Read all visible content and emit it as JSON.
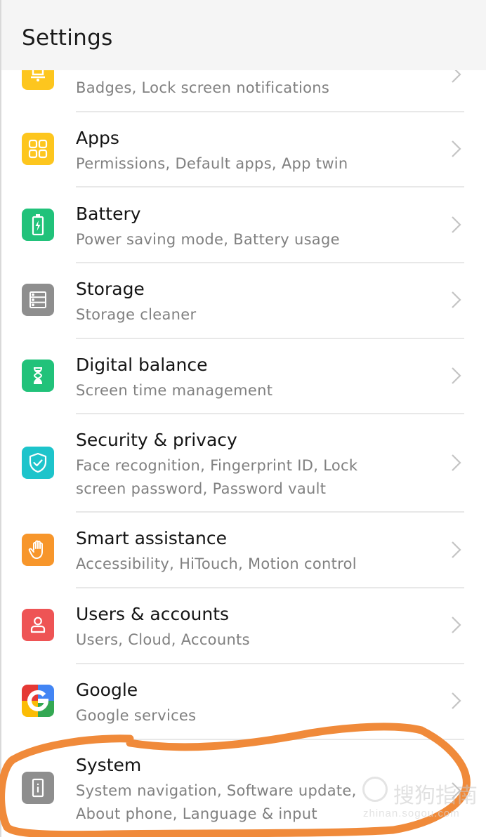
{
  "header": {
    "title": "Settings"
  },
  "items": [
    {
      "key": "notifications",
      "title": "",
      "subtitle_lines": [
        "Badges, Lock screen notifications"
      ],
      "icon": "bell-icon",
      "icon_color": "#FDC61E"
    },
    {
      "key": "apps",
      "title": "Apps",
      "subtitle_lines": [
        "Permissions, Default apps, App twin"
      ],
      "icon": "apps-grid-icon",
      "icon_color": "#FDC61E"
    },
    {
      "key": "battery",
      "title": "Battery",
      "subtitle_lines": [
        "Power saving mode, Battery usage"
      ],
      "icon": "battery-icon",
      "icon_color": "#21C27A"
    },
    {
      "key": "storage",
      "title": "Storage",
      "subtitle_lines": [
        "Storage cleaner"
      ],
      "icon": "storage-icon",
      "icon_color": "#8E8E8E"
    },
    {
      "key": "digital-balance",
      "title": "Digital balance",
      "subtitle_lines": [
        "Screen time management"
      ],
      "icon": "hourglass-icon",
      "icon_color": "#21C27A"
    },
    {
      "key": "security-privacy",
      "title": "Security & privacy",
      "subtitle_lines": [
        "Face recognition, Fingerprint ID, Lock",
        "screen password, Password vault"
      ],
      "icon": "shield-check-icon",
      "icon_color": "#1DC4CB"
    },
    {
      "key": "smart-assistance",
      "title": "Smart assistance",
      "subtitle_lines": [
        "Accessibility, HiTouch, Motion control"
      ],
      "icon": "hand-icon",
      "icon_color": "#F7962B"
    },
    {
      "key": "users-accounts",
      "title": "Users & accounts",
      "subtitle_lines": [
        "Users, Cloud, Accounts"
      ],
      "icon": "user-icon",
      "icon_color": "#EE5455"
    },
    {
      "key": "google",
      "title": "Google",
      "subtitle_lines": [
        "Google services"
      ],
      "icon": "google-icon",
      "icon_color": "#4285F4"
    },
    {
      "key": "system",
      "title": "System",
      "subtitle_lines": [
        "System navigation, Software update,",
        "About phone, Language & input"
      ],
      "icon": "system-info-icon",
      "icon_color": "#8E8E8E"
    }
  ],
  "annotation": {
    "color": "#F08A3A",
    "highlighted_item": "System"
  },
  "watermark": {
    "text": "搜狗指南",
    "url": "zhinan.sogou.com"
  }
}
